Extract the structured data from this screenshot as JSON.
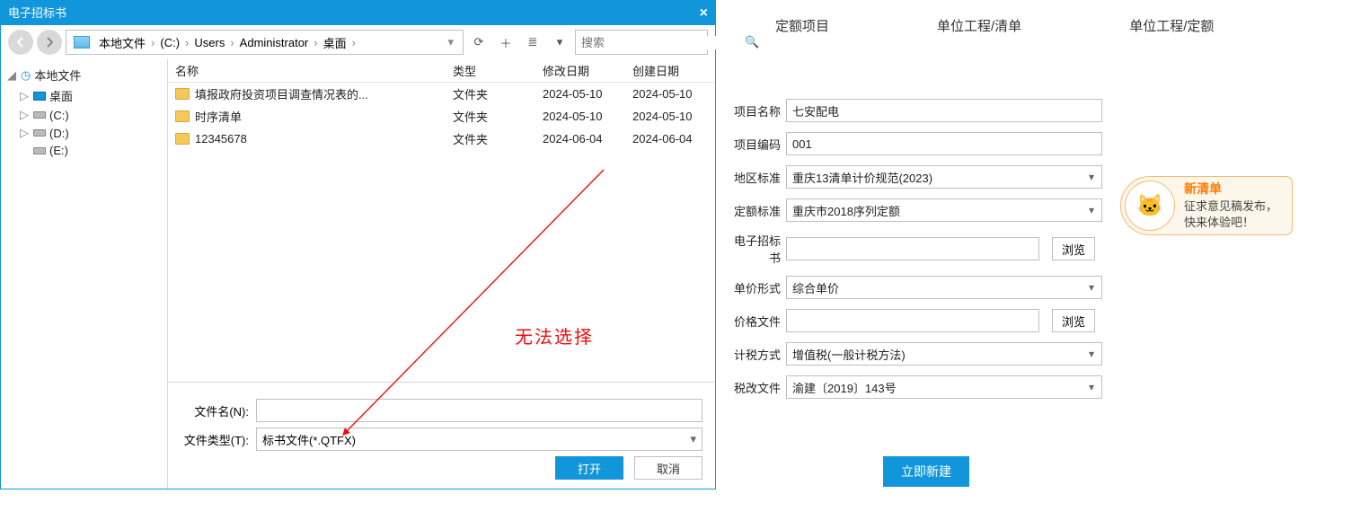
{
  "dialog": {
    "title": "电子招标书",
    "close": "×",
    "nav": {
      "back_icon": "«",
      "forward_icon": "»",
      "path": {
        "root": "本地文件",
        "drive": "(C:)",
        "users": "Users",
        "admin": "Administrator",
        "desktop": "桌面"
      },
      "dropdown": "▾"
    },
    "toolbar": {
      "refresh": "⟳",
      "newfolder": "＋",
      "viewmode": "≣",
      "viewdd": "▾"
    },
    "search": {
      "placeholder": "搜索",
      "icon": "🔍"
    },
    "tree": {
      "local_root": "本地文件",
      "items": [
        {
          "label": "桌面",
          "icon": "mon"
        },
        {
          "label": "(C:)",
          "icon": "drv"
        },
        {
          "label": "(D:)",
          "icon": "drv"
        },
        {
          "label": "(E:)",
          "icon": "drv"
        }
      ],
      "tw_expanded": "◢",
      "tw_collapsed": "▷"
    },
    "list": {
      "headers": {
        "name": "名称",
        "type": "类型",
        "mod": "修改日期",
        "crt": "创建日期"
      },
      "rows": [
        {
          "name": "填报政府投资项目调查情况表的...",
          "type": "文件夹",
          "mod": "2024-05-10",
          "crt": "2024-05-10"
        },
        {
          "name": "时序清单",
          "type": "文件夹",
          "mod": "2024-05-10",
          "crt": "2024-05-10"
        },
        {
          "name": "12345678",
          "type": "文件夹",
          "mod": "2024-06-04",
          "crt": "2024-06-04"
        }
      ]
    },
    "filename_label": "文件名(N):",
    "filetype_label": "文件类型(T):",
    "filetype_value": "标书文件(*.QTFX)",
    "open_btn": "打开",
    "cancel_btn": "取消"
  },
  "annotation_text": "无法选择",
  "form": {
    "tabs": {
      "t1": "定额项目",
      "t2": "单位工程/清单",
      "t3": "单位工程/定额"
    },
    "labels": {
      "proj_name": "项目名称",
      "proj_code": "项目编码",
      "region_std": "地区标准",
      "quota_std": "定额标准",
      "tender": "电子招标书",
      "price_form": "单价形式",
      "price_file": "价格文件",
      "tax_method": "计税方式",
      "tax_doc": "税改文件"
    },
    "values": {
      "proj_name": "七安配电",
      "proj_code": "001",
      "region_std": "重庆13清单计价规范(2023)",
      "quota_std": "重庆市2018序列定额",
      "tender": "",
      "price_form": "综合单价",
      "price_file": "",
      "tax_method": "增值税(一般计税方法)",
      "tax_doc": "渝建〔2019〕143号"
    },
    "browse": "浏览",
    "create": "立即新建"
  },
  "promo": {
    "title": "新清单",
    "line1": "征求意见稿发布，",
    "line2": "快来体验吧！",
    "face": "🐱"
  }
}
